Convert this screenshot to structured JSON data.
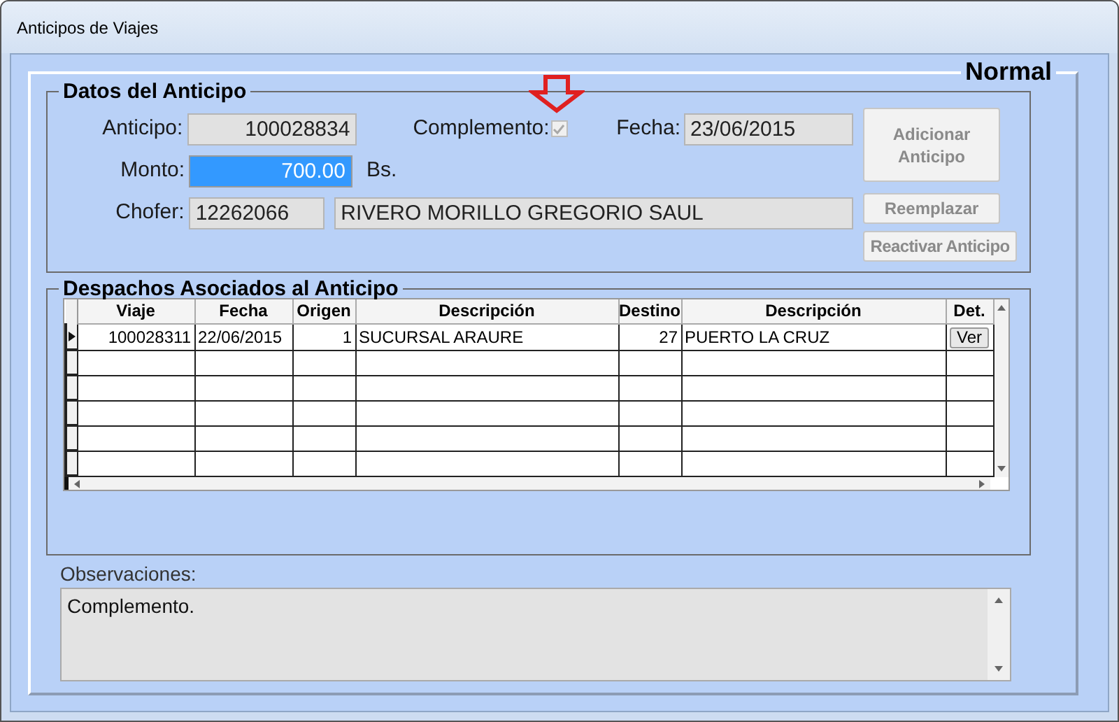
{
  "window": {
    "title": "Anticipos de Viajes"
  },
  "status_label": "Normal",
  "datos": {
    "title": "Datos del Anticipo",
    "anticipo": {
      "label": "Anticipo:",
      "value": "100028834"
    },
    "complemento": {
      "label": "Complemento:",
      "checked": true,
      "disabled": true
    },
    "fecha": {
      "label": "Fecha:",
      "value": "23/06/2015"
    },
    "monto": {
      "label": "Monto:",
      "value": "700.00",
      "selected": true,
      "unit": "Bs."
    },
    "chofer": {
      "label": "Chofer:",
      "code": "12262066",
      "name": "RIVERO MORILLO GREGORIO SAUL"
    },
    "buttons": [
      {
        "label": "Adicionar Anticipo",
        "disabled": true
      },
      {
        "label": "Reemplazar",
        "disabled": true
      },
      {
        "label": "Reactivar Anticipo",
        "disabled": true
      }
    ]
  },
  "despachos": {
    "title": "Despachos Asociados al Anticipo",
    "columns": [
      "Viaje",
      "Fecha",
      "Origen",
      "Descripción",
      "Destino",
      "Descripción",
      "Det."
    ],
    "rows": [
      {
        "current": true,
        "cells": [
          "100028311",
          "22/06/2015",
          "1",
          "SUCURSAL ARAURE",
          "27",
          "PUERTO LA CRUZ"
        ],
        "action": "Ver"
      }
    ]
  },
  "observaciones": {
    "label": "Observaciones:",
    "value": "Complemento."
  }
}
